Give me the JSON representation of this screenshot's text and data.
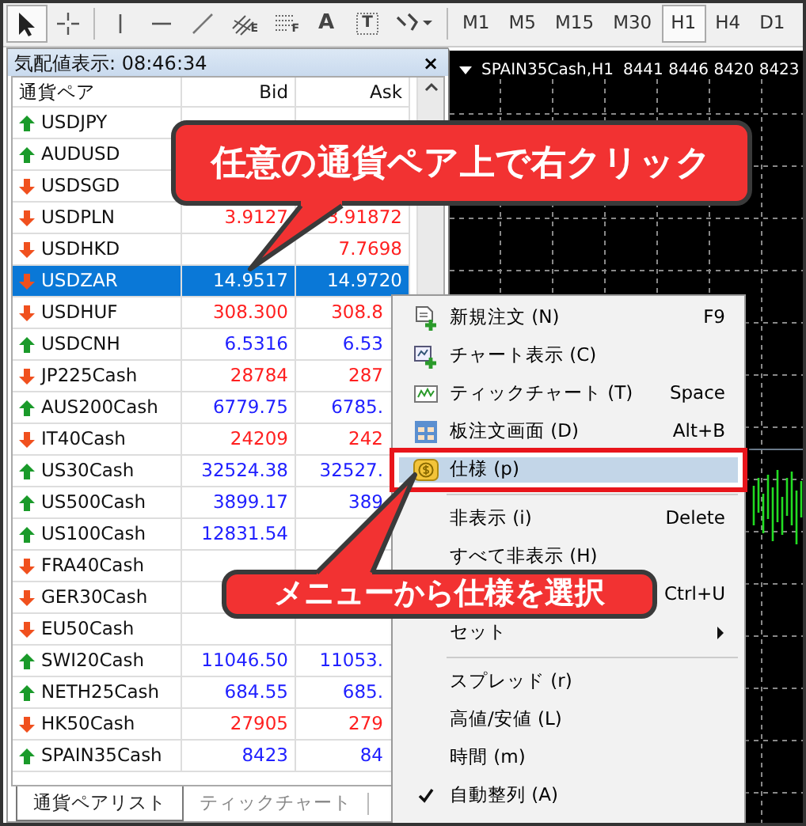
{
  "toolbar": {
    "tools": [
      {
        "kind": "cursor",
        "selected": true
      },
      {
        "kind": "crosshair",
        "selected": false
      },
      {
        "kind": "vline",
        "selected": false
      },
      {
        "kind": "hline",
        "selected": false
      },
      {
        "kind": "trend",
        "selected": false
      },
      {
        "kind": "fibchannel",
        "glyph": "E",
        "selected": false
      },
      {
        "kind": "fibo",
        "glyph": "F",
        "selected": false
      },
      {
        "kind": "text",
        "glyph": "A",
        "selected": false
      },
      {
        "kind": "label",
        "glyph": "T",
        "selected": false
      },
      {
        "kind": "shapes",
        "selected": false
      }
    ],
    "timeframes": [
      {
        "label": "M1",
        "selected": false
      },
      {
        "label": "M5",
        "selected": false
      },
      {
        "label": "M15",
        "selected": false
      },
      {
        "label": "M30",
        "selected": false
      },
      {
        "label": "H1",
        "selected": true
      },
      {
        "label": "H4",
        "selected": false
      },
      {
        "label": "D1",
        "selected": false
      }
    ]
  },
  "market_watch": {
    "title": "気配値表示: 08:46:34",
    "close": "×",
    "columns": [
      "通貨ペア",
      "Bid",
      "Ask"
    ],
    "rows": [
      {
        "symbol": "USDJPY",
        "kind": "up",
        "selected": false
      },
      {
        "symbol": "AUDUSD",
        "kind": "up",
        "selected": false
      },
      {
        "symbol": "USDSGD",
        "kind": "down",
        "selected": false
      },
      {
        "symbol": "USDPLN",
        "kind": "down",
        "bid": "3.9127",
        "ask": "3.91872",
        "selected": false
      },
      {
        "symbol": "USDHKD",
        "kind": "down",
        "ask": "7.7698",
        "selected": false
      },
      {
        "symbol": "USDZAR",
        "kind": "down",
        "bid": "14.9517",
        "ask": "14.9720",
        "selected": true
      },
      {
        "symbol": "USDHUF",
        "kind": "down",
        "bid": "308.300",
        "ask": "308.8",
        "selected": false
      },
      {
        "symbol": "USDCNH",
        "kind": "up",
        "bid": "6.5316",
        "ask": "6.53",
        "selected": false
      },
      {
        "symbol": "JP225Cash",
        "kind": "down",
        "bid": "28784",
        "ask": "287",
        "selected": false
      },
      {
        "symbol": "AUS200Cash",
        "kind": "up",
        "bid": "6779.75",
        "ask": "6785.",
        "selected": false
      },
      {
        "symbol": "IT40Cash",
        "kind": "down",
        "bid": "24209",
        "ask": "242",
        "selected": false
      },
      {
        "symbol": "US30Cash",
        "kind": "up",
        "bid": "32524.38",
        "ask": "32527.",
        "selected": false
      },
      {
        "symbol": "US500Cash",
        "kind": "up",
        "bid": "3899.17",
        "ask": "389",
        "selected": false
      },
      {
        "symbol": "US100Cash",
        "kind": "up",
        "bid": "12831.54",
        "selected": false
      },
      {
        "symbol": "FRA40Cash",
        "kind": "down",
        "selected": false
      },
      {
        "symbol": "GER30Cash",
        "kind": "down",
        "selected": false
      },
      {
        "symbol": "EU50Cash",
        "kind": "down",
        "selected": false
      },
      {
        "symbol": "SWI20Cash",
        "kind": "up",
        "bid": "11046.50",
        "ask": "11053.",
        "selected": false
      },
      {
        "symbol": "NETH25Cash",
        "kind": "up",
        "bid": "684.55",
        "ask": "685.",
        "selected": false
      },
      {
        "symbol": "HK50Cash",
        "kind": "down",
        "bid": "27905",
        "ask": "279",
        "selected": false
      },
      {
        "symbol": "SPAIN35Cash",
        "kind": "up",
        "bid": "8423",
        "ask": "84",
        "selected": false
      }
    ],
    "tabs": [
      {
        "label": "通貨ペアリスト",
        "selected": true
      },
      {
        "label": "ティックチャート",
        "selected": false
      }
    ]
  },
  "chart": {
    "symbol": "SPAIN35Cash,H1",
    "prices": "8441 8446 8420 8423"
  },
  "context_menu": {
    "items": [
      {
        "kind": "item",
        "label": "新規注文 (N)",
        "shortcut": "F9",
        "selected": false,
        "checked": false
      },
      {
        "kind": "item",
        "label": "チャート表示 (C)",
        "selected": false,
        "checked": false
      },
      {
        "kind": "item",
        "label": "ティックチャート (T)",
        "shortcut": "Space",
        "selected": false,
        "checked": false
      },
      {
        "kind": "item",
        "label": "板注文画面 (D)",
        "shortcut": "Alt+B",
        "selected": false,
        "checked": false
      },
      {
        "kind": "item",
        "label": "仕様 (p)",
        "selected": true,
        "checked": false
      },
      {
        "kind": "separator"
      },
      {
        "kind": "item",
        "label": "非表示 (i)",
        "shortcut": "Delete",
        "selected": false,
        "checked": false
      },
      {
        "kind": "item",
        "label": "すべて非表示 (H)",
        "selected": false,
        "checked": false
      },
      {
        "kind": "item",
        "shortcut": "Ctrl+U",
        "selected": false
      },
      {
        "kind": "submenu",
        "label": "セット",
        "selected": false,
        "checked": false
      },
      {
        "kind": "separator"
      },
      {
        "kind": "item",
        "label": "スプレッド (r)",
        "selected": false,
        "checked": false
      },
      {
        "kind": "item",
        "label": "高値/安値 (L)",
        "selected": false,
        "checked": false
      },
      {
        "kind": "item",
        "label": "時間 (m)",
        "selected": false,
        "checked": false
      },
      {
        "kind": "item",
        "label": "自動整列 (A)",
        "selected": false,
        "checked": true
      }
    ]
  },
  "callouts": [
    {
      "text": "任意の通貨ペア上で右クリック"
    },
    {
      "text": "メニューから仕様を選択"
    }
  ]
}
